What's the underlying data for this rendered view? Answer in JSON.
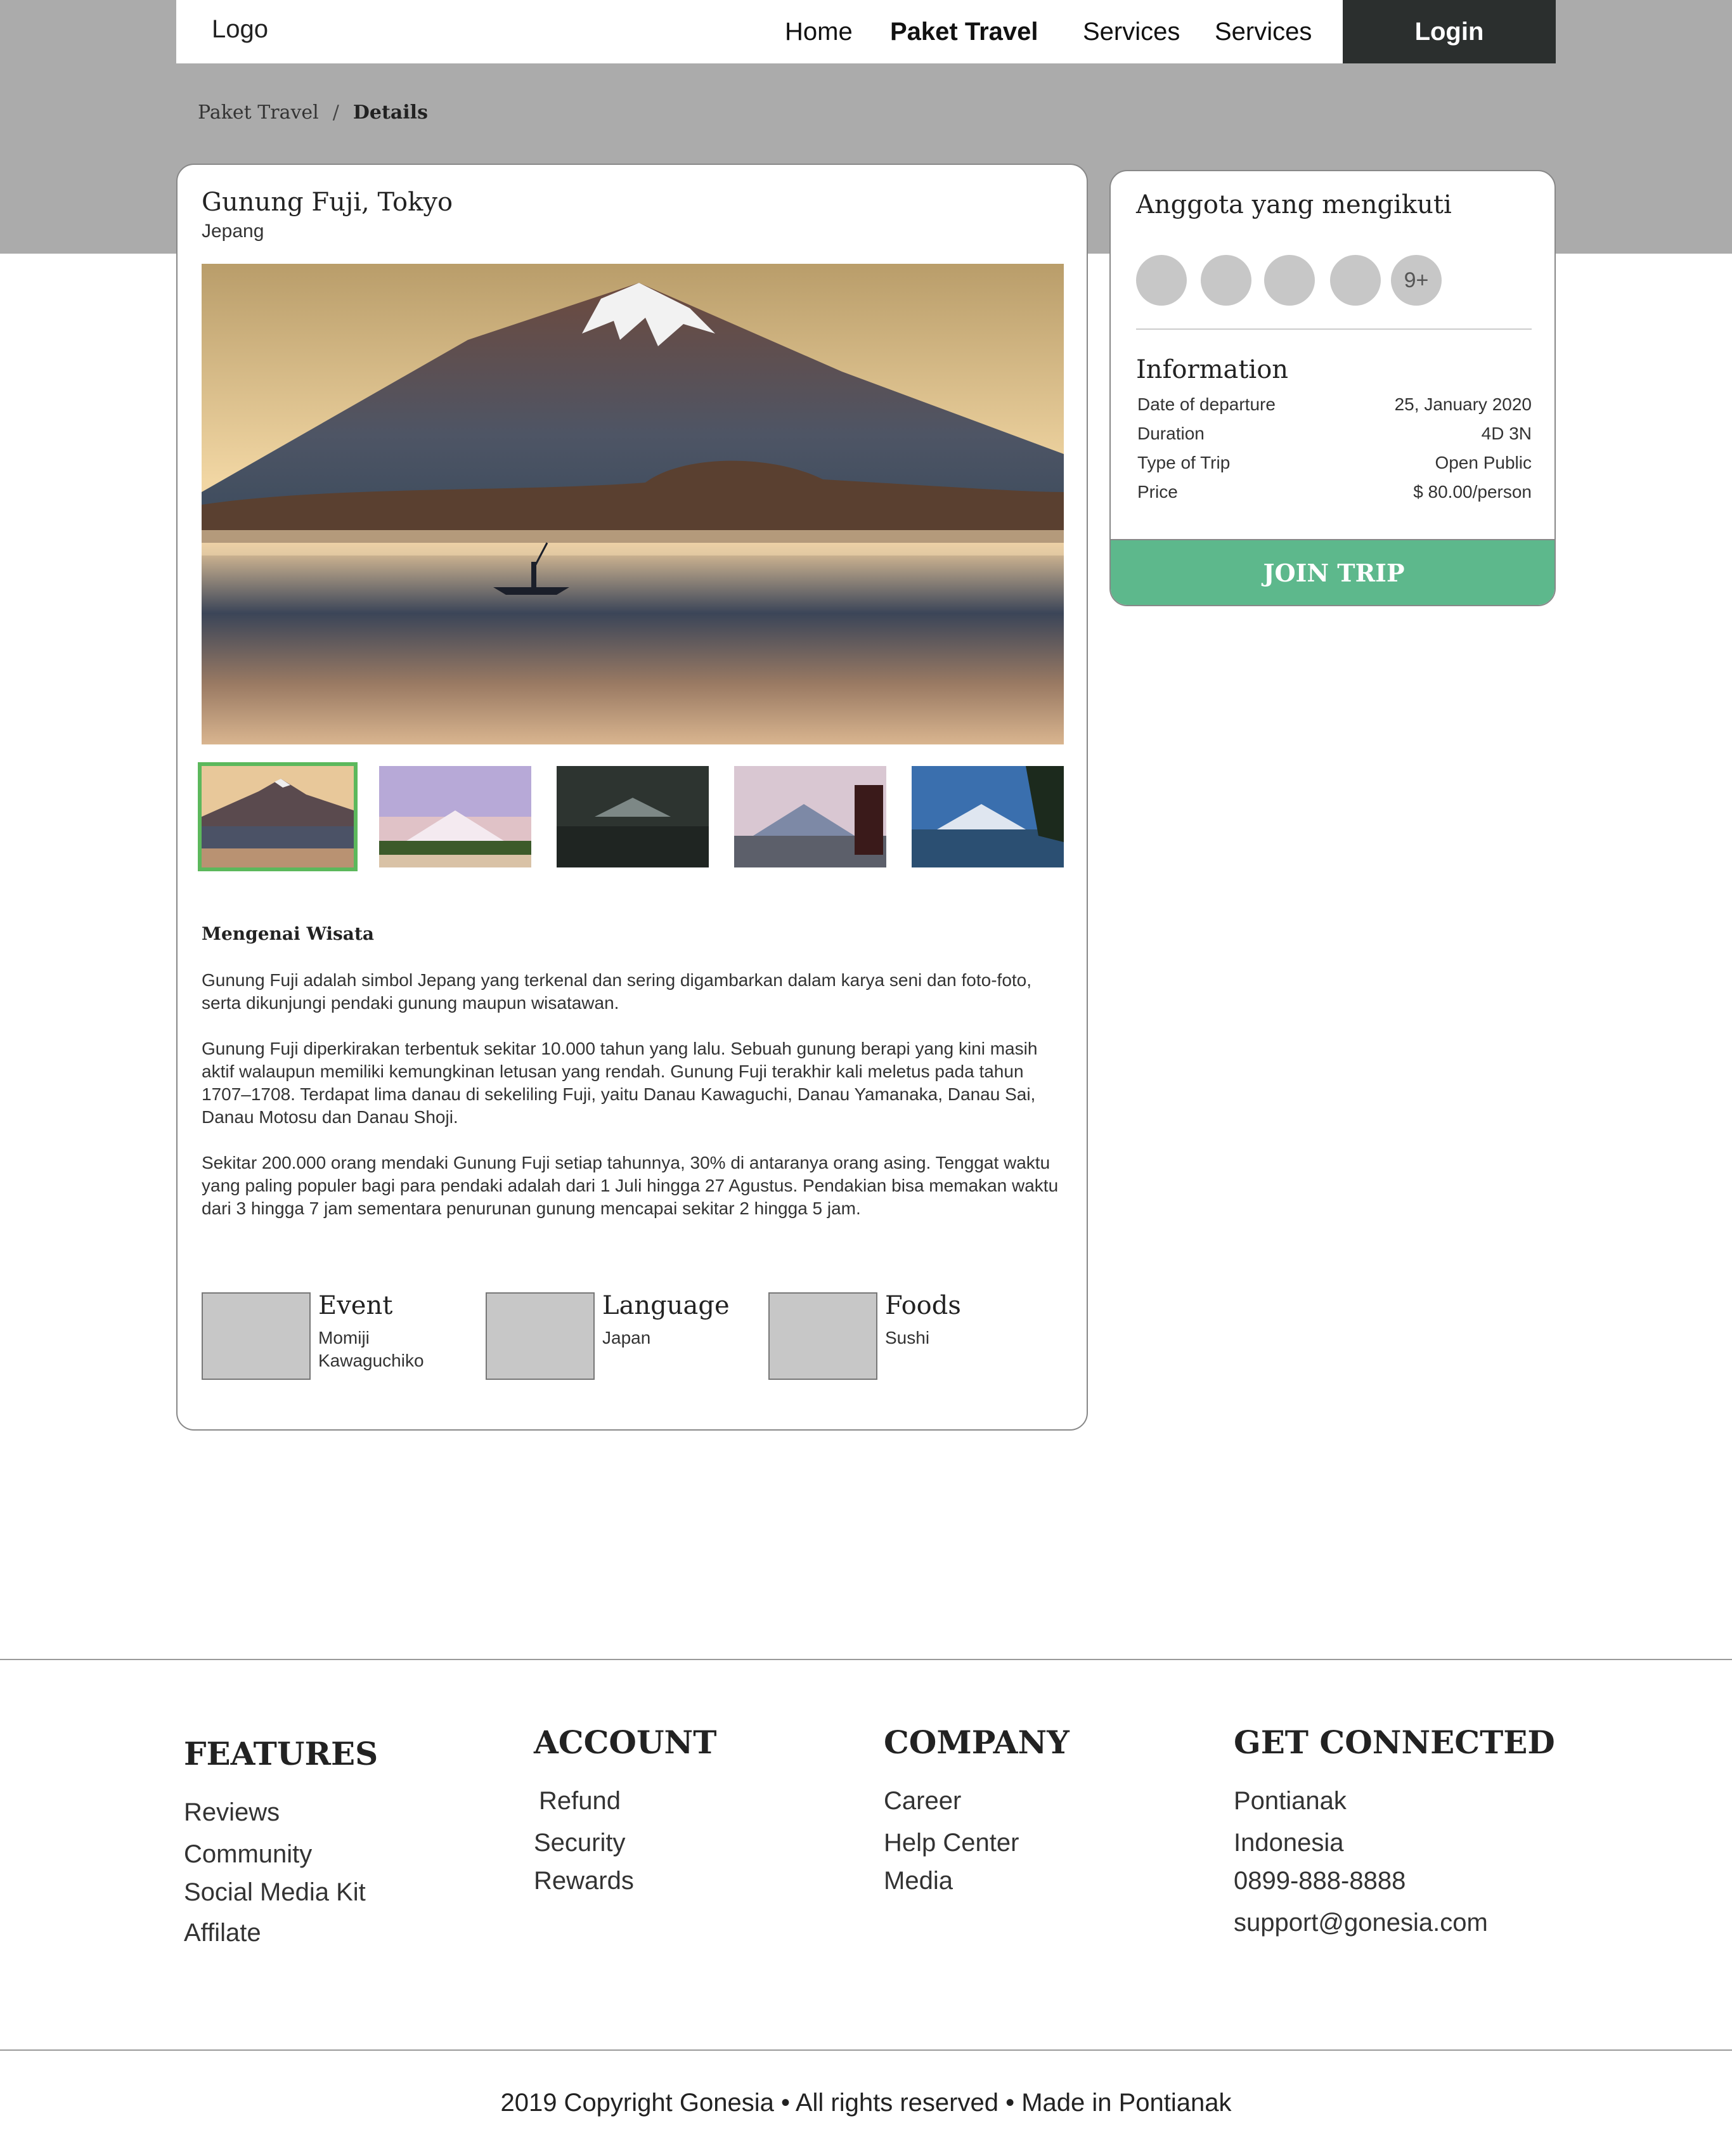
{
  "nav": {
    "logo": "Logo",
    "links": [
      "Home",
      "Paket Travel",
      "Services",
      "Services"
    ],
    "login": "Login"
  },
  "breadcrumb": {
    "parent": "Paket Travel",
    "separator": "/",
    "current": "Details"
  },
  "trip": {
    "title": "Gunung Fuji, Tokyo",
    "country": "Jepang"
  },
  "about": {
    "heading": "Mengenai Wisata",
    "paragraphs": [
      "Gunung Fuji adalah simbol Jepang yang terkenal dan sering digambarkan dalam karya seni dan foto-foto, serta dikunjungi pendaki gunung maupun wisatawan.",
      "Gunung Fuji diperkirakan terbentuk sekitar 10.000 tahun yang lalu. Sebuah gunung berapi yang kini masih aktif walaupun memiliki kemungkinan letusan yang rendah. Gunung Fuji terakhir kali meletus pada tahun 1707–1708. Terdapat lima danau di sekeliling Fuji, yaitu Danau Kawaguchi, Danau Yamanaka, Danau Sai, Danau Motosu dan Danau Shoji.",
      "Sekitar 200.000 orang mendaki Gunung Fuji setiap tahunnya, 30% di antaranya orang asing. Tenggat waktu yang paling populer bagi para pendaki adalah dari 1 Juli hingga 27 Agustus. Pendakian bisa memakan waktu dari 3 hingga 7 jam sementara penurunan gunung mencapai sekitar 2 hingga 5 jam."
    ]
  },
  "features": [
    {
      "title": "Event",
      "value": "Momiji Kawaguchiko"
    },
    {
      "title": "Language",
      "value": "Japan"
    },
    {
      "title": "Foods",
      "value": "Sushi"
    }
  ],
  "members": {
    "title": "Anggota yang mengikuti",
    "more": "9+"
  },
  "information": {
    "title": "Information",
    "rows": [
      {
        "label": "Date of departure",
        "value": "25, January 2020"
      },
      {
        "label": "Duration",
        "value": "4D 3N"
      },
      {
        "label": "Type of Trip",
        "value": "Open Public"
      },
      {
        "label": "Price",
        "value": "$ 80.00/person"
      }
    ],
    "cta": "JOIN TRIP"
  },
  "footer": {
    "columns": [
      {
        "heading": "FEATURES",
        "items": [
          "Reviews",
          "Community",
          "Social Media Kit",
          "Affilate"
        ]
      },
      {
        "heading": "ACCOUNT",
        "items": [
          "Refund",
          "Security",
          "Rewards"
        ]
      },
      {
        "heading": "COMPANY",
        "items": [
          "Career",
          "Help Center",
          "Media"
        ]
      },
      {
        "heading": "GET CONNECTED",
        "items": [
          "Pontianak",
          "Indonesia",
          "0899-888-8888",
          "support@gonesia.com"
        ]
      }
    ],
    "copyright": "2019 Copyright Gonesia • All rights reserved • Made in Pontianak"
  },
  "colors": {
    "accent_green": "#5db88c",
    "thumb_active": "#5cb85c",
    "login_bg": "#2b2f2e",
    "hero_band": "#ababab"
  }
}
